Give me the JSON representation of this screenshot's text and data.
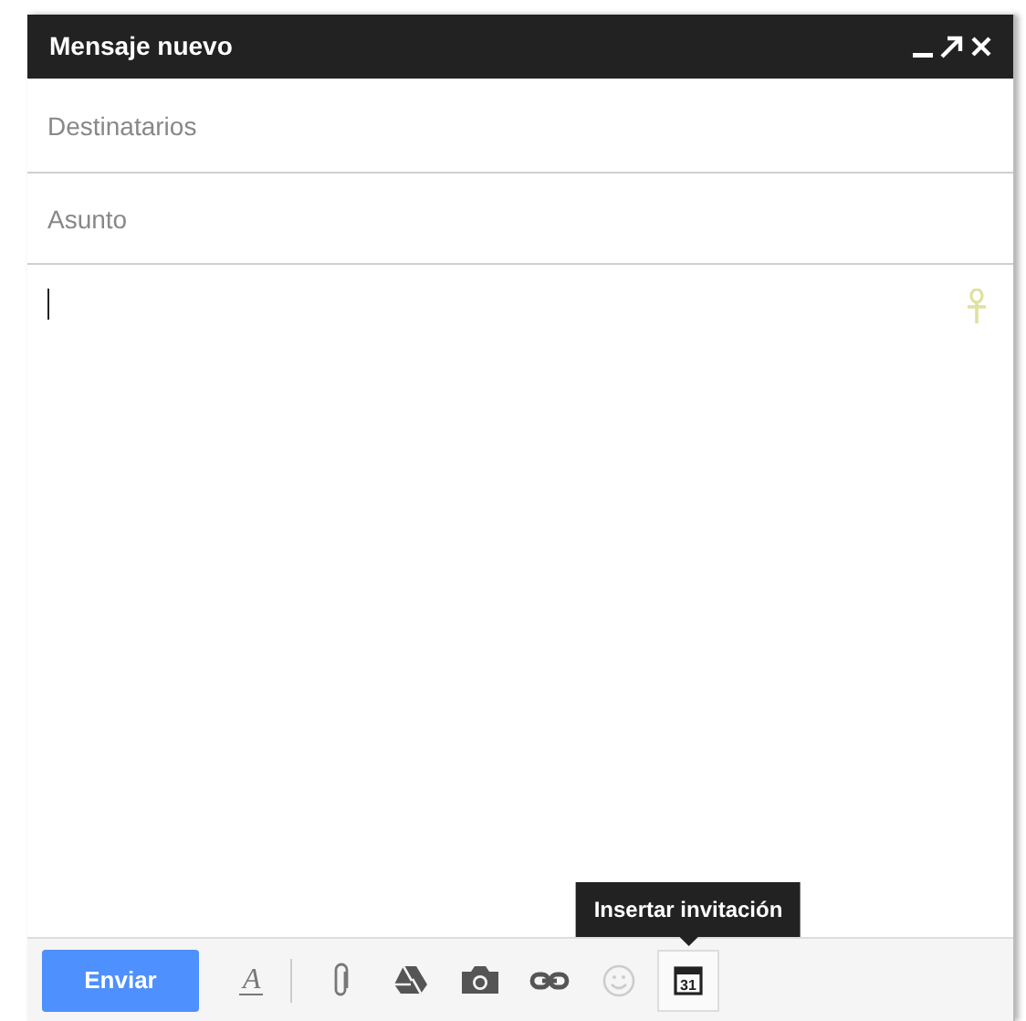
{
  "window": {
    "title": "Mensaje nuevo"
  },
  "recipients": {
    "placeholder": "Destinatarios"
  },
  "subject": {
    "placeholder": "Asunto"
  },
  "send_button": "Enviar",
  "tools": [
    {
      "kind": "format",
      "disabled": false,
      "selected": false,
      "glyph": "A"
    },
    {
      "kind": "attach",
      "disabled": false,
      "selected": false
    },
    {
      "kind": "drive",
      "disabled": false,
      "selected": false
    },
    {
      "kind": "photo",
      "disabled": false,
      "selected": false
    },
    {
      "kind": "link",
      "disabled": false,
      "selected": false
    },
    {
      "kind": "emoji",
      "disabled": true,
      "selected": false
    },
    {
      "kind": "calendar",
      "disabled": false,
      "selected": true,
      "day": "31"
    }
  ],
  "tooltip": "Insertar invitación"
}
